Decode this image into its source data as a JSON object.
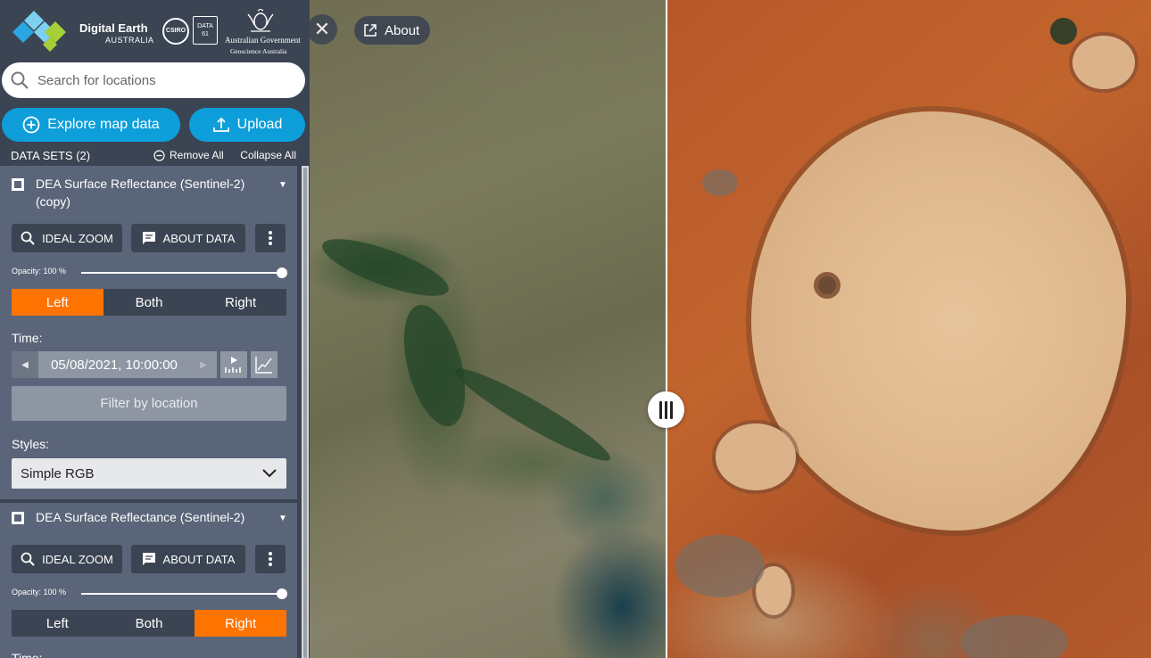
{
  "header": {
    "brand_title": "Digital Earth",
    "brand_sub": "AUSTRALIA",
    "csiro": "CSIRO",
    "data61": "DATA 61",
    "gov_title": "Australian Government",
    "gov_sub": "Geoscience Australia"
  },
  "search": {
    "placeholder": "Search for locations"
  },
  "actions": {
    "explore_label": "Explore map data",
    "upload_label": "Upload"
  },
  "datasets": {
    "title": "DATA SETS (2)",
    "remove_all": "Remove All",
    "collapse_all": "Collapse All",
    "items": [
      {
        "name": "DEA Surface Reflectance (Sentinel-2) (copy)",
        "ideal_zoom": "IDEAL ZOOM",
        "about_data": "ABOUT DATA",
        "opacity": "Opacity: 100 %",
        "opacity_value": 1.0,
        "compare": [
          "Left",
          "Both",
          "Right"
        ],
        "compare_selected": "Left",
        "time_label": "Time:",
        "date": "05/08/2021, 10:00:00",
        "filter_label": "Filter by location",
        "styles_label": "Styles:",
        "style_value": "Simple RGB"
      },
      {
        "name": "DEA Surface Reflectance (Sentinel-2)",
        "ideal_zoom": "IDEAL ZOOM",
        "about_data": "ABOUT DATA",
        "opacity": "Opacity: 100 %",
        "opacity_value": 1.0,
        "compare": [
          "Left",
          "Both",
          "Right"
        ],
        "compare_selected": "Right",
        "time_label": "Time:"
      }
    ]
  },
  "map": {
    "about_label": "About"
  },
  "colors": {
    "accent": "#0e9ed9",
    "active_segment": "#ff7300",
    "sidebar_bg": "#3b4452",
    "panel_bg": "#5b6579"
  }
}
